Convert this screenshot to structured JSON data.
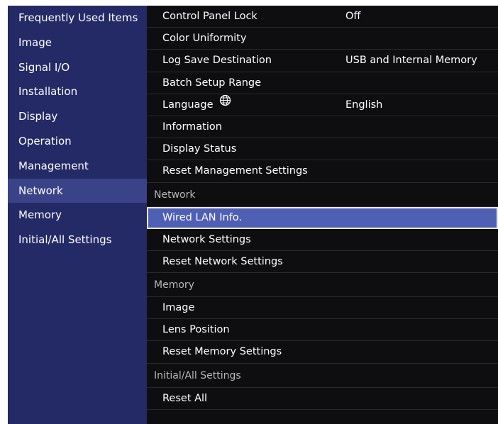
{
  "sidebar": {
    "items": [
      {
        "label": "Frequently Used Items"
      },
      {
        "label": "Image"
      },
      {
        "label": "Signal I/O"
      },
      {
        "label": "Installation"
      },
      {
        "label": "Display"
      },
      {
        "label": "Operation"
      },
      {
        "label": "Management"
      },
      {
        "label": "Network",
        "active": true
      },
      {
        "label": "Memory"
      },
      {
        "label": "Initial/All Settings"
      }
    ]
  },
  "main": {
    "management_rows": [
      {
        "label": "Control Panel Lock",
        "value": "Off"
      },
      {
        "label": "Color Uniformity",
        "value": ""
      },
      {
        "label": "Log Save Destination",
        "value": "USB and Internal Memory"
      },
      {
        "label": "Batch Setup Range",
        "value": ""
      },
      {
        "label": "Language",
        "value": "English",
        "icon": "globe-icon"
      },
      {
        "label": "Information",
        "value": ""
      },
      {
        "label": "Display Status",
        "value": ""
      },
      {
        "label": "Reset Management Settings",
        "value": ""
      }
    ],
    "network_section": {
      "title": "Network",
      "rows": [
        {
          "label": "Wired LAN Info.",
          "selected": true
        },
        {
          "label": "Network Settings"
        },
        {
          "label": "Reset Network Settings"
        }
      ]
    },
    "memory_section": {
      "title": "Memory",
      "rows": [
        {
          "label": "Image"
        },
        {
          "label": "Lens Position"
        },
        {
          "label": "Reset Memory Settings"
        }
      ]
    },
    "initial_section": {
      "title": "Initial/All Settings",
      "rows": [
        {
          "label": "Reset All"
        }
      ]
    }
  },
  "colors": {
    "sidebar_bg": "#232a66",
    "sidebar_active": "#3a4288",
    "main_bg": "#0e0e10",
    "selected_bg": "#4f5fb4"
  }
}
